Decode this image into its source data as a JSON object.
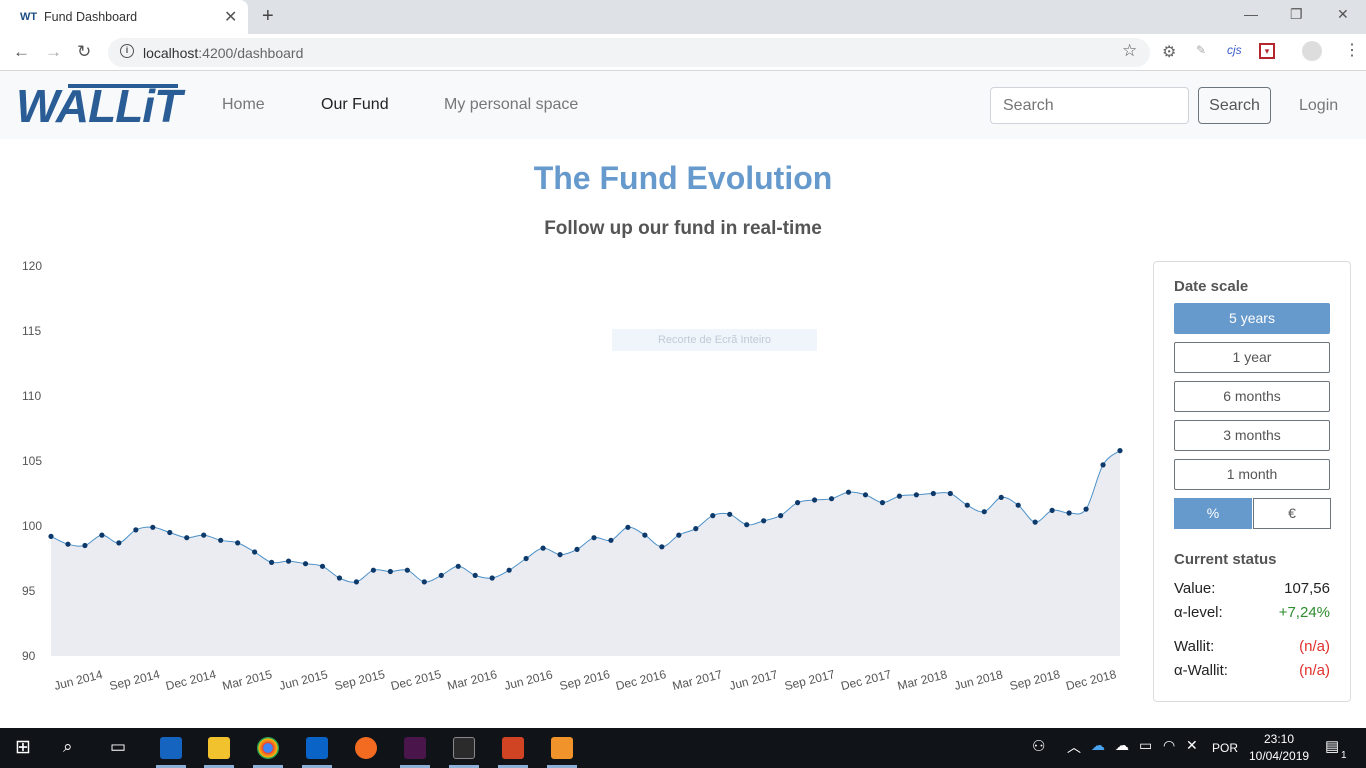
{
  "browser": {
    "tab_title": "Fund Dashboard",
    "tab_favicon": "WT",
    "tab_close": "✕",
    "new_tab": "+",
    "url_host": "localhost",
    "url_path": ":4200/dashboard",
    "ext_cjs": "cjs"
  },
  "navbar": {
    "logo": "WALLiT",
    "links": [
      "Home",
      "Our Fund",
      "My personal space"
    ],
    "active_link": "Our Fund",
    "search_placeholder": "Search",
    "search_button": "Search",
    "login": "Login"
  },
  "page": {
    "title": "The Fund Evolution",
    "subtitle": "Follow up our fund in real-time",
    "snip_overlay": "Recorte de Ecrã Inteiro"
  },
  "panel": {
    "date_scale_heading": "Date scale",
    "scales": [
      "5 years",
      "1 year",
      "6 months",
      "3 months",
      "1 month"
    ],
    "active_scale": "5 years",
    "unit_percent": "%",
    "unit_euro": "€",
    "active_unit": "%",
    "status_heading": "Current status",
    "value_label": "Value:",
    "value": "107,56",
    "alpha_label": "α-level:",
    "alpha_value": "+7,24%",
    "wallit_label": "Wallit:",
    "wallit_value": "(n/a)",
    "alpha_wallit_label": "α-Wallit:",
    "alpha_wallit_value": "(n/a)"
  },
  "colors": {
    "accent": "#6699cc",
    "positive": "#2e8b2e",
    "negative": "#e0312b",
    "line": "#4a90c8",
    "area": "#ebecf1",
    "point": "#0e3a6b"
  },
  "taskbar": {
    "language": "POR",
    "time": "23:10",
    "date": "10/04/2019",
    "notification_count": "1"
  },
  "chart_data": {
    "type": "area",
    "title": "",
    "xlabel": "",
    "ylabel": "",
    "ylim": [
      90,
      120
    ],
    "yticks": [
      90,
      95,
      100,
      105,
      110,
      115,
      120
    ],
    "xtick_labels": [
      "Jun 2014",
      "Sep 2014",
      "Dec 2014",
      "Mar 2015",
      "Jun 2015",
      "Sep 2015",
      "Dec 2015",
      "Mar 2016",
      "Jun 2016",
      "Sep 2016",
      "Dec 2016",
      "Mar 2017",
      "Jun 2017",
      "Sep 2017",
      "Dec 2017",
      "Mar 2018",
      "Jun 2018",
      "Sep 2018",
      "Dec 2018"
    ],
    "series": [
      {
        "values": [
          99.2,
          98.6,
          98.5,
          99.3,
          98.7,
          99.7,
          99.9,
          99.5,
          99.1,
          99.3,
          98.9,
          98.7,
          98.0,
          97.2,
          97.3,
          97.1,
          96.9,
          96.0,
          95.7,
          96.6,
          96.5,
          96.6,
          95.7,
          96.2,
          96.9,
          96.2,
          96.0,
          96.6,
          97.5,
          98.3,
          97.8,
          98.2,
          99.1,
          98.9,
          99.9,
          99.3,
          98.4,
          99.3,
          99.8,
          100.8,
          100.9,
          100.1,
          100.4,
          100.8,
          101.8,
          102.0,
          102.1,
          102.6,
          102.4,
          101.8,
          102.3,
          102.4,
          102.5,
          102.5,
          101.6,
          101.1,
          102.2,
          101.6,
          100.3,
          101.2,
          101.0,
          101.3,
          104.7,
          105.8
        ]
      }
    ]
  }
}
